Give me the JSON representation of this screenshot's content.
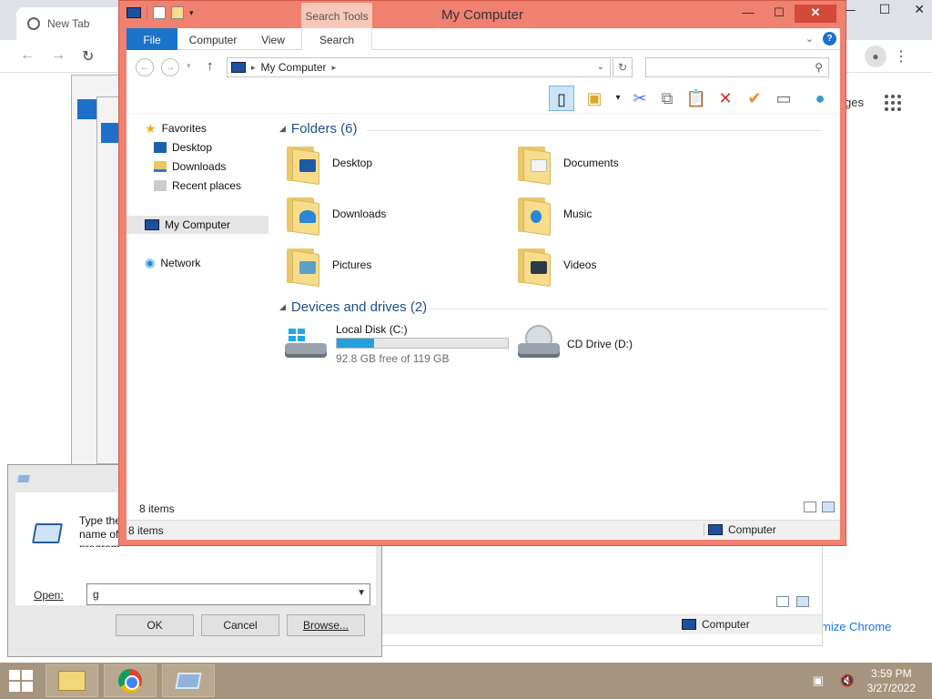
{
  "chrome": {
    "tab_title": "New Tab",
    "partial_text": "ges",
    "customize_label": "mize Chrome"
  },
  "run_dialog": {
    "description": "Type the name of a program, folder, document, or Internet resource, and Windows will open it for you.",
    "open_label": "Open:",
    "open_value": "g",
    "ok": "OK",
    "cancel": "Cancel",
    "browse": "Browse..."
  },
  "behind_explorer": {
    "status_location": "Computer"
  },
  "explorer": {
    "window_title": "My Computer",
    "context_tab": "Search Tools",
    "ribbon_tabs": [
      "File",
      "Computer",
      "View",
      "Search"
    ],
    "address": "My Computer",
    "search_placeholder": "",
    "nav": {
      "favorites": "Favorites",
      "desktop": "Desktop",
      "downloads": "Downloads",
      "recent": "Recent places",
      "my_computer": "My Computer",
      "network": "Network"
    },
    "folders_header": "Folders (6)",
    "folders": [
      "Desktop",
      "Documents",
      "Downloads",
      "Music",
      "Pictures",
      "Videos"
    ],
    "drives_header": "Devices and drives (2)",
    "drives": [
      {
        "name": "Local Disk (C:)",
        "free_text": "92.8 GB free of 119 GB",
        "used_fraction": 0.22
      },
      {
        "name": "CD Drive (D:)"
      }
    ],
    "item_count": "8 items",
    "status_items": "8 items",
    "status_location": "Computer"
  },
  "taskbar": {
    "time": "3:59 PM",
    "date": "3/27/2022"
  }
}
